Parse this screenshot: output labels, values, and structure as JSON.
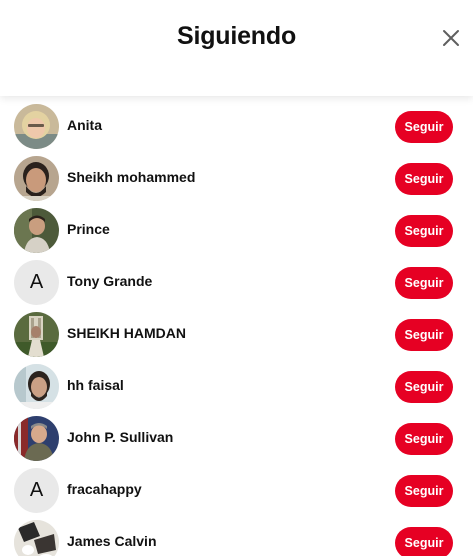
{
  "modal": {
    "title": "Siguiendo",
    "close_icon": "close-icon"
  },
  "colors": {
    "accent": "#e60023",
    "placeholder_avatar": "#e9e9e9"
  },
  "users": [
    {
      "name": "Anita",
      "avatar": "photo",
      "button": "Seguir"
    },
    {
      "name": "Sheikh mohammed",
      "avatar": "photo",
      "button": "Seguir"
    },
    {
      "name": "Prince",
      "avatar": "photo",
      "button": "Seguir"
    },
    {
      "name": "Tony Grande",
      "avatar": "initial",
      "initial": "A",
      "button": "Seguir"
    },
    {
      "name": "SHEIKH HAMDAN",
      "avatar": "photo",
      "button": "Seguir"
    },
    {
      "name": "hh faisal",
      "avatar": "photo",
      "button": "Seguir"
    },
    {
      "name": "John P. Sullivan",
      "avatar": "photo",
      "button": "Seguir"
    },
    {
      "name": "fracahappy",
      "avatar": "initial",
      "initial": "A",
      "button": "Seguir"
    },
    {
      "name": "James Calvin",
      "avatar": "photo",
      "button": "Seguir"
    }
  ]
}
